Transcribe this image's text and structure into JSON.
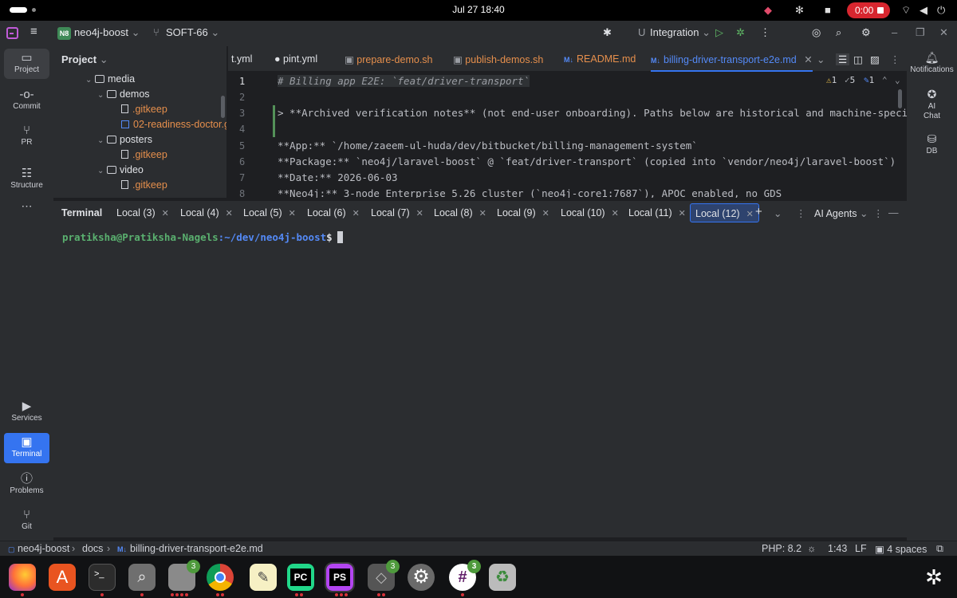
{
  "os": {
    "clock": "Jul 27  18:40",
    "recording": "0:00"
  },
  "titlebar": {
    "project_badge": "N8",
    "project": "neo4j-boost",
    "branch": "SOFT-66",
    "run_config": "Integration"
  },
  "left_strip": [
    "Project",
    "Commit",
    "PR",
    "Structure",
    "Services",
    "Terminal",
    "Problems",
    "Git"
  ],
  "right_strip": [
    "Notifications",
    "AI Chat",
    "DB"
  ],
  "project_panel": {
    "title": "Project",
    "tree": [
      {
        "label": "media",
        "type": "folder"
      },
      {
        "label": "demos",
        "type": "folder"
      },
      {
        "label": ".gitkeep",
        "type": "file"
      },
      {
        "label": "02-readiness-doctor.g",
        "type": "image"
      },
      {
        "label": "posters",
        "type": "folder"
      },
      {
        "label": ".gitkeep",
        "type": "file"
      },
      {
        "label": "video",
        "type": "folder"
      },
      {
        "label": ".gitkeep",
        "type": "file"
      }
    ]
  },
  "editor": {
    "tabs": [
      "t.yml",
      "pint.yml",
      "prepare-demo.sh",
      "publish-demos.sh",
      "README.md",
      "billing-driver-transport-e2e.md"
    ],
    "inspections": {
      "warnings": "1",
      "weak": "5",
      "typos": "1"
    },
    "lines": [
      {
        "n": "1",
        "text": "# Billing app E2E: `feat/driver-transport`"
      },
      {
        "n": "2",
        "text": ""
      },
      {
        "n": "3",
        "text": "> **Archived verification notes** (not end-user onboarding). Paths below are historical and machine-specific. Pr"
      },
      {
        "n": "4",
        "text": ""
      },
      {
        "n": "5",
        "text": "**App:** `/home/zaeem-ul-huda/dev/bitbucket/billing-management-system`"
      },
      {
        "n": "6",
        "text": "**Package:** `neo4j/laravel-boost` @ `feat/driver-transport` (copied into `vendor/neo4j/laravel-boost`)"
      },
      {
        "n": "7",
        "text": "**Date:** 2026-06-03"
      },
      {
        "n": "8",
        "text": "**Neo4j:** 3-node Enterprise 5.26 cluster (`neo4j-core1:7687`), APOC enabled, no GDS"
      }
    ]
  },
  "terminal": {
    "title": "Terminal",
    "tabs": [
      "Local (3)",
      "Local (4)",
      "Local (5)",
      "Local (6)",
      "Local (7)",
      "Local (8)",
      "Local (9)",
      "Local (10)",
      "Local (11)",
      "Local (12)"
    ],
    "ai_agents": "AI Agents",
    "prompt_user": "pratiksha@Pratiksha-Nagels",
    "prompt_path": ":~/dev/neo4j-boost",
    "prompt_symbol": "$"
  },
  "statusbar": {
    "crumbs": [
      "neo4j-boost",
      "docs",
      "billing-driver-transport-e2e.md"
    ],
    "php": "PHP: 8.2",
    "position": "1:43",
    "line_ending": "LF",
    "indent": "4 spaces"
  },
  "dock": {
    "badges": [
      "3",
      "3",
      "3"
    ]
  }
}
